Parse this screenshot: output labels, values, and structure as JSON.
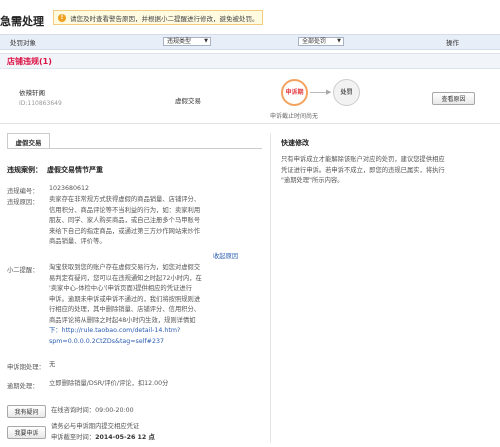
{
  "page": {
    "title": "急需处理",
    "notice": "请您及时查看警告原因，并根据小二提醒进行修改，避免被处罚。"
  },
  "table_header": {
    "object": "处罚对象",
    "violation_type": "违规类型",
    "penalty": "全部处罚",
    "action": "操作"
  },
  "section": {
    "title": "店铺违规(1)"
  },
  "row": {
    "shop_name": "依辣轩阁",
    "shop_id": "ID:110863649",
    "type": "虚假交易",
    "step1": "申诉期",
    "step2": "处罚",
    "deadline": "申诉截止时间尚无",
    "view_button": "查看原因"
  },
  "detail": {
    "tab": "虚假交易",
    "case_label": "违规案例：",
    "case_value": "虚假交易情节严重",
    "id_label": "违规编号：",
    "id_value": "1023680612",
    "reason_label": "违规原因：",
    "reason_lines": [
      "卖家存在非常规方式获得虚假的商品销量、店铺评分、",
      "信用积分、商品评论等不当利益的行为，如：卖家利用",
      "朋友、同学、家人购买商品，或自己注册多个马甲账号",
      "来给下自己的指定商品，或通过第三方炒作网站来炒作",
      "商品销量、评价等。"
    ],
    "collapse": "收起原因",
    "reminder_label": "小二提醒：",
    "reminder_lines": [
      "淘宝获取到您的账户存在虚假交易行为，如您对虚假交",
      "易判定有疑问，您可以在违规通知之时起72小时内，在",
      "'卖家中心-体检中心'(申诉页面)提供相应的凭证进行",
      "申诉。逾期未申诉或申诉不通过的，我们将按照规则进",
      "行相应的处理，其中删除销量、店铺评分、信用积分、",
      "商品评论将从删除之时起48小时内生效，规则详情如",
      "下：http://rule.taobao.com/detail-14.htm?",
      "spm=0.0.0.0.2CtZDs&tag=self#237"
    ],
    "appeal_label": "申诉期处理：",
    "appeal_value": "无",
    "overdue_label": "逾期处理：",
    "overdue_value": "立即删除销量/DSR/评价/评论，扣12.00分",
    "question_button": "我有疑问",
    "online_time": "在线咨询时间：09:00-20:00",
    "appeal_button": "我要申诉",
    "appeal_hint": "请务必与申诉期内提交相应凭证",
    "appeal_deadline_label": "申诉截至时间：",
    "appeal_deadline_value": "2014-05-26 12 点"
  },
  "sidebar": {
    "title": "快速修改",
    "lines": [
      "只有申诉成立才能解除该账户对应的处罚，建议您提供相应",
      "凭证进行申诉。若申诉不成立，即您的违规已属实，将执行",
      "\"逾期处理\"所示内容。"
    ]
  },
  "colors": {
    "accent_red": "#e4393c",
    "link_blue": "#2a5db0",
    "header_bg": "#e8eef7",
    "notice_bg": "#fffbe0"
  }
}
